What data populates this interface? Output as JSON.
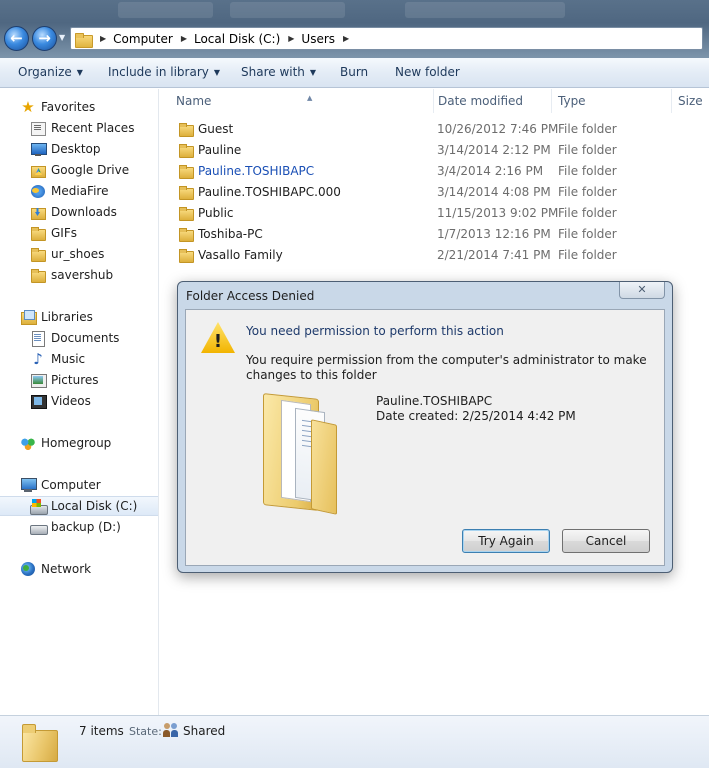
{
  "address": {
    "crumbs": [
      "Computer",
      "Local Disk (C:)",
      "Users"
    ]
  },
  "toolbar": {
    "organize": "Organize",
    "include_in_library": "Include in library",
    "share_with": "Share with",
    "burn": "Burn",
    "new_folder": "New folder"
  },
  "sidebar": {
    "favorites": {
      "header": "Favorites",
      "items": [
        "Recent Places",
        "Desktop",
        "Google Drive",
        "MediaFire",
        "Downloads",
        "GIFs",
        "ur_shoes",
        "savershub"
      ]
    },
    "libraries": {
      "header": "Libraries",
      "items": [
        "Documents",
        "Music",
        "Pictures",
        "Videos"
      ]
    },
    "homegroup": "Homegroup",
    "computer": {
      "header": "Computer",
      "items": [
        "Local Disk (C:)",
        "backup (D:)"
      ]
    },
    "network": "Network"
  },
  "columns": {
    "name": "Name",
    "date_modified": "Date modified",
    "type": "Type",
    "size": "Size"
  },
  "files": [
    {
      "name": "Guest",
      "date": "10/26/2012 7:46 PM",
      "type": "File folder"
    },
    {
      "name": "Pauline",
      "date": "3/14/2014 2:12 PM",
      "type": "File folder"
    },
    {
      "name": "Pauline.TOSHIBAPC",
      "date": "3/4/2014 2:16 PM",
      "type": "File folder"
    },
    {
      "name": "Pauline.TOSHIBAPC.000",
      "date": "3/14/2014 4:08 PM",
      "type": "File folder"
    },
    {
      "name": "Public",
      "date": "11/15/2013 9:02 PM",
      "type": "File folder"
    },
    {
      "name": "Toshiba-PC",
      "date": "1/7/2013 12:16 PM",
      "type": "File folder"
    },
    {
      "name": "Vasallo Family",
      "date": "2/21/2014 7:41 PM",
      "type": "File folder"
    }
  ],
  "status": {
    "count": "7 items",
    "state_label": "State:",
    "state_value": "Shared"
  },
  "dialog": {
    "title": "Folder Access Denied",
    "heading": "You need permission to perform this action",
    "message": "You require permission from the computer's administrator to make changes to this folder",
    "item_name": "Pauline.TOSHIBAPC",
    "item_date": "Date created: 2/25/2014 4:42 PM",
    "try_again": "Try Again",
    "cancel": "Cancel"
  }
}
